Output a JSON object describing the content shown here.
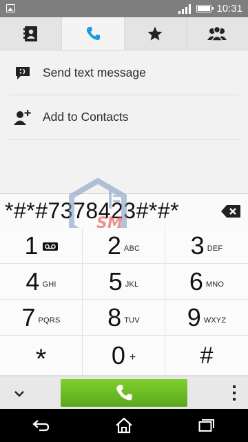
{
  "status_bar": {
    "time": "10:31",
    "icons": [
      "image-icon",
      "signal-icon",
      "battery-icon"
    ]
  },
  "tabs": [
    {
      "name": "contacts",
      "icon": "contacts-book-icon",
      "active": false
    },
    {
      "name": "dialer",
      "icon": "phone-icon",
      "active": true
    },
    {
      "name": "favorites",
      "icon": "star-icon",
      "active": false
    },
    {
      "name": "groups",
      "icon": "group-icon",
      "active": false
    }
  ],
  "actions": [
    {
      "label": "Send text message",
      "icon": "message-icon"
    },
    {
      "label": "Add to Contacts",
      "icon": "add-contact-icon"
    }
  ],
  "dialer": {
    "number": "*#*#7378423#*#*",
    "backspace_icon": "backspace-icon"
  },
  "keys": [
    {
      "digit": "1",
      "letters": "",
      "icon": "voicemail-icon"
    },
    {
      "digit": "2",
      "letters": "ABC"
    },
    {
      "digit": "3",
      "letters": "DEF"
    },
    {
      "digit": "4",
      "letters": "GHI"
    },
    {
      "digit": "5",
      "letters": "JKL"
    },
    {
      "digit": "6",
      "letters": "MNO"
    },
    {
      "digit": "7",
      "letters": "PQRS"
    },
    {
      "digit": "8",
      "letters": "TUV"
    },
    {
      "digit": "9",
      "letters": "WXYZ"
    },
    {
      "digit": "*",
      "letters": ""
    },
    {
      "digit": "0",
      "letters": "+"
    },
    {
      "digit": "#",
      "letters": ""
    }
  ],
  "watermark": {
    "text": "SM"
  },
  "callbar": {
    "call_icon": "phone-icon",
    "call_color": "#6cbd25"
  },
  "navbar": {
    "icons": [
      "back-icon",
      "home-icon",
      "recents-icon"
    ]
  },
  "colors": {
    "accent": "#1e9be0",
    "call_green": "#6cbd25",
    "statusbar": "#7e7e7e"
  }
}
